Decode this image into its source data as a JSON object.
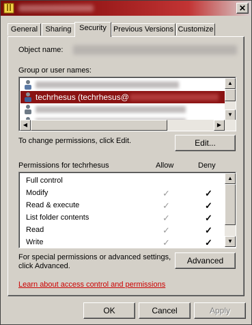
{
  "window": {
    "close_glyph": "✕"
  },
  "tabs": [
    {
      "label": "General"
    },
    {
      "label": "Sharing"
    },
    {
      "label": "Security"
    },
    {
      "label": "Previous Versions"
    },
    {
      "label": "Customize"
    }
  ],
  "security": {
    "object_name_label": "Object name:",
    "group_label": "Group or user names:",
    "users": [
      {
        "label": ""
      },
      {
        "label": "techrhesus (techrhesus@"
      },
      {
        "label": ""
      },
      {
        "label": ""
      }
    ],
    "change_hint": "To change permissions, click Edit.",
    "edit_button": "Edit...",
    "permissions_label": "Permissions for techrhesus",
    "allow_header": "Allow",
    "deny_header": "Deny",
    "permissions": [
      {
        "name": "Full control",
        "allow": "",
        "deny": ""
      },
      {
        "name": "Modify",
        "allow": "✓",
        "deny": "✓"
      },
      {
        "name": "Read & execute",
        "allow": "✓",
        "deny": "✓"
      },
      {
        "name": "List folder contents",
        "allow": "✓",
        "deny": "✓"
      },
      {
        "name": "Read",
        "allow": "✓",
        "deny": "✓"
      },
      {
        "name": "Write",
        "allow": "✓",
        "deny": "✓"
      }
    ],
    "advanced_hint_line1": "For special permissions or advanced settings,",
    "advanced_hint_line2": "click Advanced.",
    "advanced_button": "Advanced",
    "learn_link": "Learn about access control and permissions"
  },
  "footer": {
    "ok": "OK",
    "cancel": "Cancel",
    "apply": "Apply"
  },
  "colors": {
    "selection": "#8a1212",
    "link": "#cc0000",
    "title_start": "#7a0c0c"
  }
}
